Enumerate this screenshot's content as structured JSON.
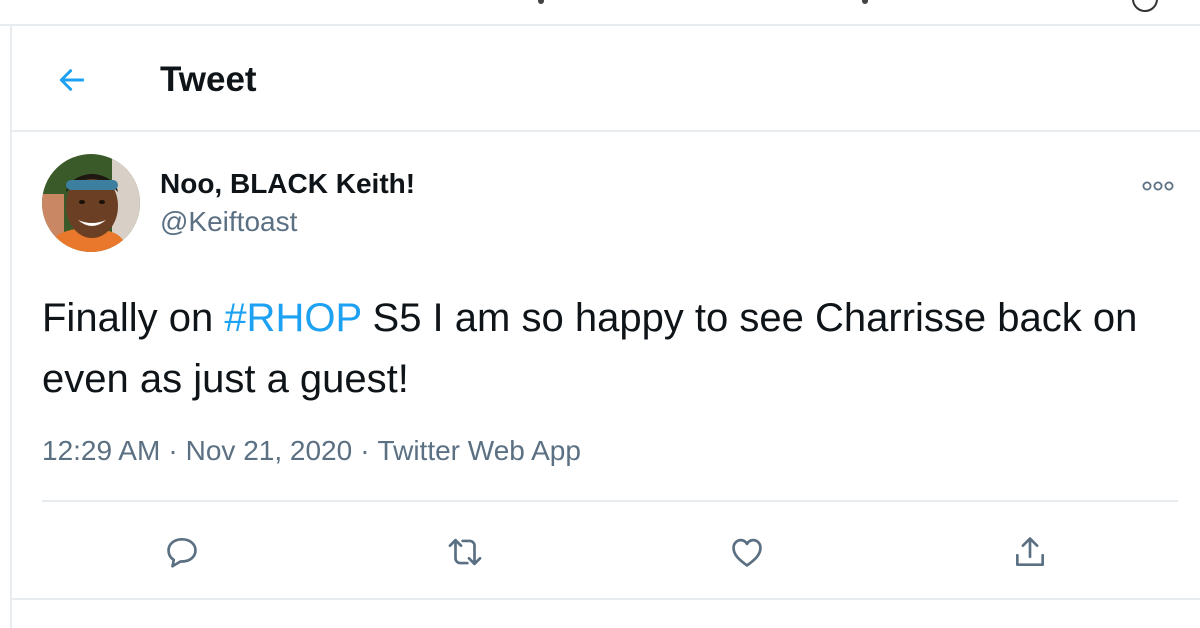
{
  "header": {
    "title": "Tweet"
  },
  "tweet": {
    "author": {
      "display_name": "Noo, BLACK Keith!",
      "handle": "@Keiftoast"
    },
    "text_before": "Finally on ",
    "hashtag": "#RHOP",
    "text_after": " S5 I am so happy to see Charrisse back on even as just a guest!",
    "time": "12:29 AM",
    "date": "Nov 21, 2020",
    "separator": "·",
    "source": "Twitter Web App"
  },
  "colors": {
    "accent": "#1da1f2",
    "secondary_text": "#5b7083",
    "border": "#e6ecf0"
  },
  "icons": {
    "back": "arrow-left-icon",
    "more": "more-options-icon",
    "actions": [
      "reply-icon",
      "retweet-icon",
      "like-icon",
      "share-icon"
    ]
  }
}
